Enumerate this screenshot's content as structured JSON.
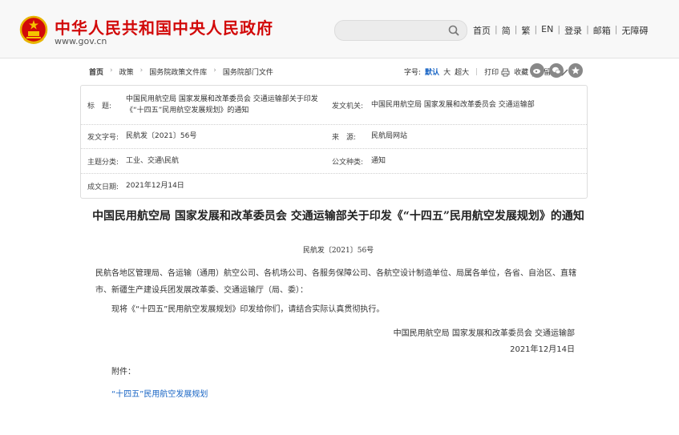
{
  "header": {
    "site_title": "中华人民共和国中央人民政府",
    "site_url": "www.gov.cn",
    "search_placeholder": "",
    "nav": [
      "首页",
      "简",
      "繁",
      "EN",
      "登录",
      "邮箱",
      "无障碍"
    ]
  },
  "breadcrumb": [
    "首页",
    "政策",
    "国务院政策文件库",
    "国务院部门文件"
  ],
  "toolbar": {
    "font_label": "字号:",
    "font_default": "默认",
    "font_large": "大",
    "font_xlarge": "超大",
    "print": "打印",
    "favorite": "收藏",
    "comment": "留言"
  },
  "info": {
    "title_label": "标　题:",
    "title_value": "中国民用航空局 国家发展和改革委员会 交通运输部关于印发《“十四五”民用航空发展规划》的通知",
    "issuer_label": "发文机关:",
    "issuer_value": "中国民用航空局 国家发展和改革委员会 交通运输部",
    "docno_label": "发文字号:",
    "docno_value": "民航发〔2021〕56号",
    "source_label": "来　源:",
    "source_value": "民航局网站",
    "topic_label": "主题分类:",
    "topic_value": "工业、交通\\民航",
    "category_label": "公文种类:",
    "category_value": "通知",
    "date_label": "成文日期:",
    "date_value": "2021年12月14日"
  },
  "article": {
    "title": "中国民用航空局 国家发展和改革委员会 交通运输部关于印发《“十四五”民用航空发展规划》的通知",
    "docno": "民航发〔2021〕56号",
    "recipients": "民航各地区管理局、各运输（通用）航空公司、各机场公司、各服务保障公司、各航空设计制造单位、局属各单位，各省、自治区、直辖市、新疆生产建设兵团发展改革委、交通运输厅（局、委）：",
    "body": "现将《“十四五”民用航空发展规划》印发给你们，请结合实际认真贯彻执行。",
    "signature": "中国民用航空局 国家发展和改革委员会 交通运输部",
    "date": "2021年12月14日",
    "attachment_label": "附件：",
    "attachment_link": "“十四五”民用航空发展规划"
  },
  "colors": {
    "brand_red": "#d20a0a",
    "link_blue": "#1a66c5"
  }
}
